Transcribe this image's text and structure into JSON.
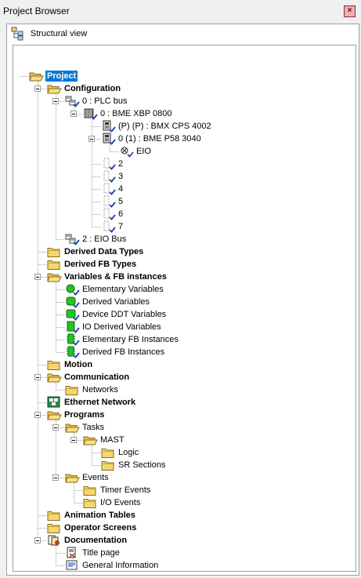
{
  "window": {
    "title": "Project Browser",
    "close_label": "×"
  },
  "view": {
    "label": "Structural view"
  },
  "tree": [
    {
      "label": "Project",
      "icon": "folder-open-icon",
      "bold": true,
      "selected": true
    },
    {
      "label": "Configuration",
      "icon": "folder-open-icon",
      "bold": true
    },
    {
      "label": "0 : PLC bus",
      "icon": "plc-bus-icon"
    },
    {
      "label": "0 : BME XBP 0800",
      "icon": "rack-icon"
    },
    {
      "label": "(P) (P) : BMX CPS 4002",
      "icon": "module-icon"
    },
    {
      "label": "0 (1) : BME P58 3040",
      "icon": "module-icon"
    },
    {
      "label": "EIO",
      "icon": "eio-icon"
    },
    {
      "label": "2",
      "icon": "empty-slot-icon"
    },
    {
      "label": "3",
      "icon": "empty-slot-icon"
    },
    {
      "label": "4",
      "icon": "empty-slot-icon"
    },
    {
      "label": "5",
      "icon": "empty-slot-icon"
    },
    {
      "label": "6",
      "icon": "empty-slot-icon"
    },
    {
      "label": "7",
      "icon": "empty-slot-icon"
    },
    {
      "label": "2 : EIO Bus",
      "icon": "plc-bus-icon"
    },
    {
      "label": "Derived Data Types",
      "icon": "folder-icon",
      "bold": true
    },
    {
      "label": "Derived FB Types",
      "icon": "folder-icon",
      "bold": true
    },
    {
      "label": "Variables & FB instances",
      "icon": "folder-open-icon",
      "bold": true
    },
    {
      "label": "Elementary Variables",
      "icon": "elementary-variable-icon"
    },
    {
      "label": "Derived Variables",
      "icon": "derived-variable-icon"
    },
    {
      "label": "Device DDT Variables",
      "icon": "device-ddt-icon"
    },
    {
      "label": "IO Derived Variables",
      "icon": "io-derived-icon"
    },
    {
      "label": "Elementary FB Instances",
      "icon": "fb-instance-icon"
    },
    {
      "label": "Derived FB Instances",
      "icon": "fb-instance-icon"
    },
    {
      "label": "Motion",
      "icon": "folder-icon",
      "bold": true
    },
    {
      "label": "Communication",
      "icon": "folder-open-icon",
      "bold": true
    },
    {
      "label": "Networks",
      "icon": "folder-icon"
    },
    {
      "label": "Ethernet Network",
      "icon": "ethernet-network-icon",
      "bold": true
    },
    {
      "label": "Programs",
      "icon": "folder-open-icon",
      "bold": true
    },
    {
      "label": "Tasks",
      "icon": "folder-open-icon"
    },
    {
      "label": "MAST",
      "icon": "folder-open-icon"
    },
    {
      "label": "Logic",
      "icon": "folder-icon"
    },
    {
      "label": "SR Sections",
      "icon": "folder-icon"
    },
    {
      "label": "Events",
      "icon": "folder-open-icon"
    },
    {
      "label": "Timer Events",
      "icon": "folder-icon"
    },
    {
      "label": "I/O Events",
      "icon": "folder-icon"
    },
    {
      "label": "Animation Tables",
      "icon": "folder-icon",
      "bold": true
    },
    {
      "label": "Operator Screens",
      "icon": "folder-icon",
      "bold": true
    },
    {
      "label": "Documentation",
      "icon": "documentation-icon",
      "bold": true
    },
    {
      "label": "Title page",
      "icon": "title-page-icon"
    },
    {
      "label": "General Information",
      "icon": "general-info-icon"
    }
  ],
  "colors": {
    "selection": "#0078d7",
    "folder": "#f5d770",
    "green": "#22c422",
    "check": "#1c3fb3"
  }
}
